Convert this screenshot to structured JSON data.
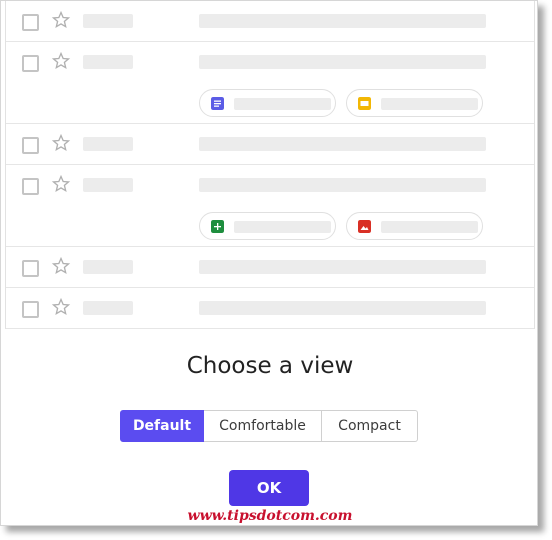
{
  "dialog": {
    "title": "Choose a view",
    "options": [
      "Default",
      "Comfortable",
      "Compact"
    ],
    "selected": "Default",
    "ok_label": "OK"
  },
  "colors": {
    "accent": "#4f37e6",
    "docs_icon": "#5b5ce6",
    "slides_icon": "#f2b705",
    "sheets_icon": "#1e8e3e",
    "image_icon": "#d93025",
    "watermark": "#c8102e"
  },
  "attachments": {
    "row2": [
      "docs-icon",
      "slides-icon"
    ],
    "row4": [
      "sheets-icon",
      "image-icon"
    ]
  },
  "watermark": "www.tipsdotcom.com"
}
